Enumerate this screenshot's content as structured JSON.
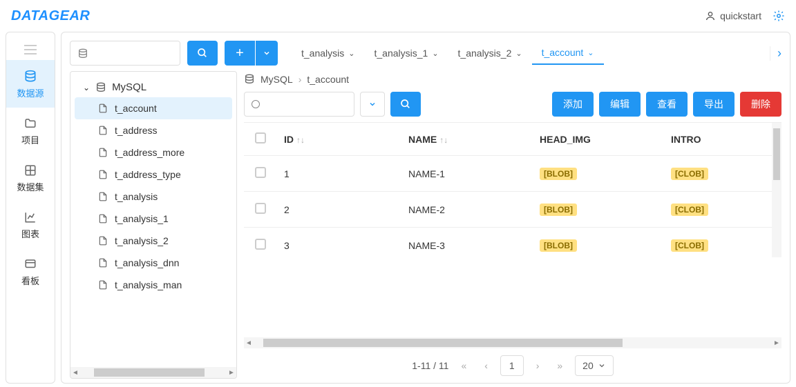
{
  "app": {
    "logo": "DATAGEAR",
    "user": "quickstart"
  },
  "sidenav": {
    "items": [
      {
        "label": "数据源",
        "icon": "db"
      },
      {
        "label": "项目",
        "icon": "folder"
      },
      {
        "label": "数据集",
        "icon": "grid"
      },
      {
        "label": "图表",
        "icon": "chart"
      },
      {
        "label": "看板",
        "icon": "panel"
      }
    ]
  },
  "tabs": [
    {
      "label": "t_analysis"
    },
    {
      "label": "t_analysis_1"
    },
    {
      "label": "t_analysis_2"
    },
    {
      "label": "t_account",
      "active": true
    }
  ],
  "tree": {
    "db": "MySQL",
    "items": [
      "t_account",
      "t_address",
      "t_address_more",
      "t_address_type",
      "t_analysis",
      "t_analysis_1",
      "t_analysis_2",
      "t_analysis_dnn",
      "t_analysis_man"
    ],
    "selected": "t_account"
  },
  "breadcrumb": {
    "db": "MySQL",
    "table": "t_account"
  },
  "actions": {
    "add": "添加",
    "edit": "编辑",
    "view": "查看",
    "export": "导出",
    "delete": "删除"
  },
  "table": {
    "headers": [
      "ID",
      "NAME",
      "HEAD_IMG",
      "INTRO"
    ],
    "rows": [
      {
        "id": "1",
        "name": "NAME-1",
        "head_img": "[BLOB]",
        "intro": "[CLOB]"
      },
      {
        "id": "2",
        "name": "NAME-2",
        "head_img": "[BLOB]",
        "intro": "[CLOB]"
      },
      {
        "id": "3",
        "name": "NAME-3",
        "head_img": "[BLOB]",
        "intro": "[CLOB]"
      }
    ]
  },
  "pager": {
    "range": "1-11 / 11",
    "current": "1",
    "size": "20"
  }
}
